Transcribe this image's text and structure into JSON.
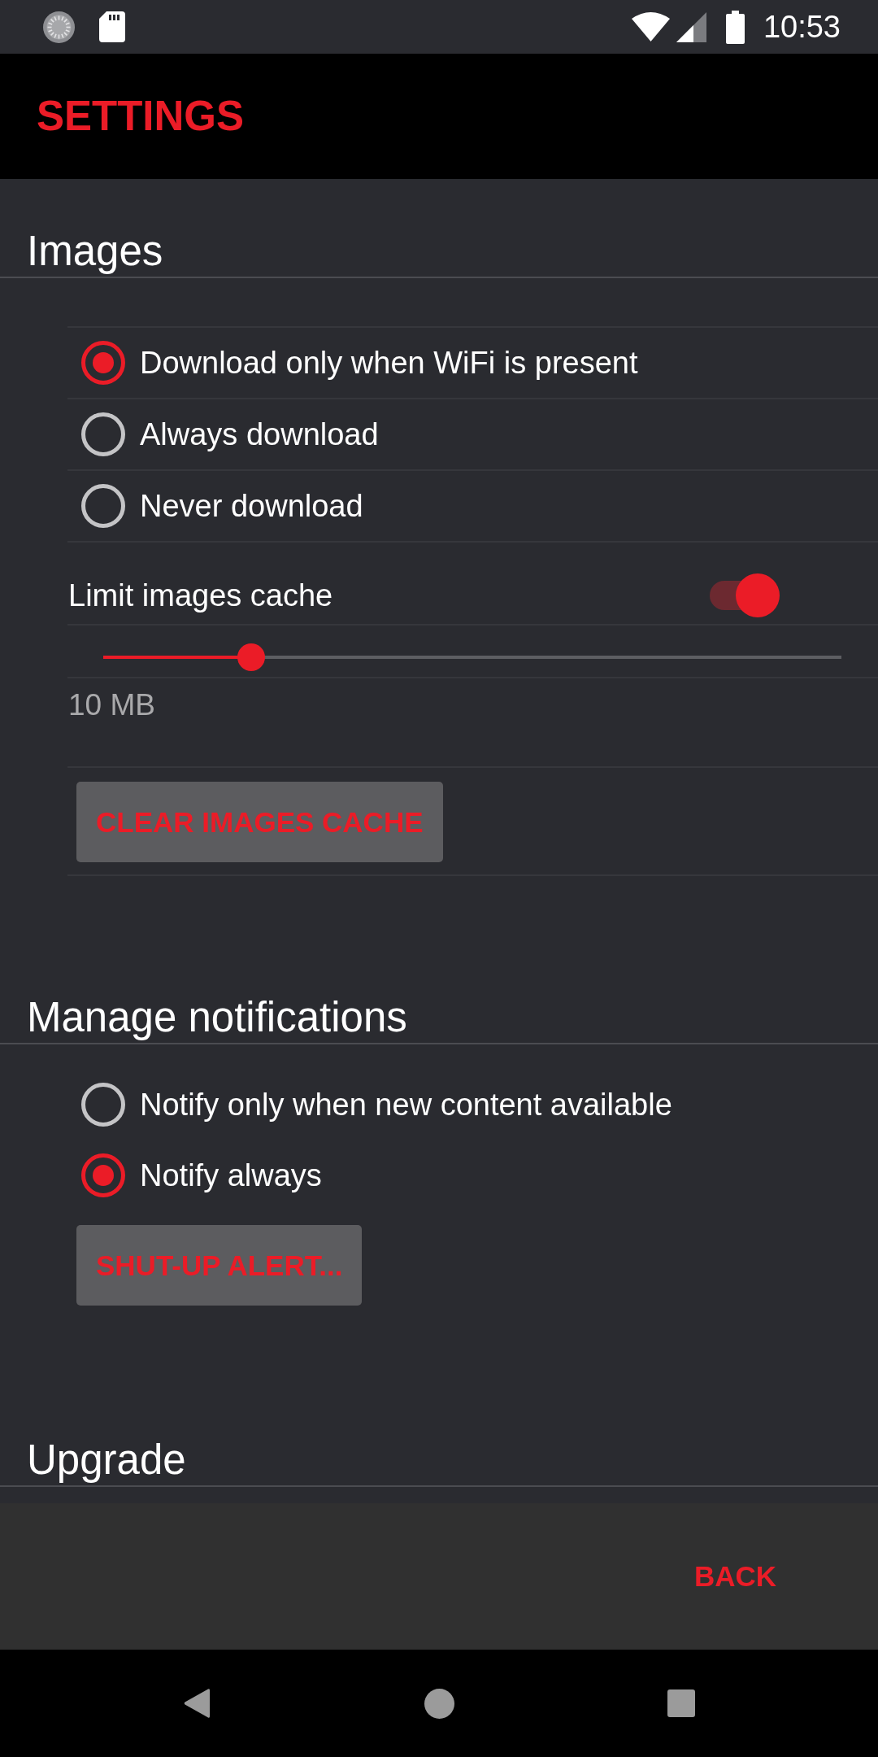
{
  "status_bar": {
    "time": "10:53"
  },
  "app_bar": {
    "title": "SETTINGS"
  },
  "sections": [
    {
      "title": "Images",
      "dividers": true,
      "items": [
        {
          "kind": "radio",
          "label": "Download only when WiFi is present",
          "selected": true
        },
        {
          "kind": "radio",
          "label": "Always download",
          "selected": false
        },
        {
          "kind": "radio",
          "label": "Never download",
          "selected": false
        },
        {
          "kind": "switch",
          "label": "Limit images cache",
          "on": true
        },
        {
          "kind": "slider",
          "level": 0.2
        },
        {
          "kind": "value",
          "text": "10 MB"
        },
        {
          "kind": "button",
          "label": "CLEAR IMAGES CACHE"
        }
      ]
    },
    {
      "title": "Manage notifications",
      "dividers": false,
      "items": [
        {
          "kind": "radio",
          "label": "Notify only when new content available",
          "selected": false
        },
        {
          "kind": "radio",
          "label": "Notify always",
          "selected": true
        },
        {
          "kind": "button",
          "label": "SHUT-UP ALERT..."
        }
      ]
    },
    {
      "title": "Upgrade"
    }
  ],
  "footer": {
    "button": "BACK"
  }
}
